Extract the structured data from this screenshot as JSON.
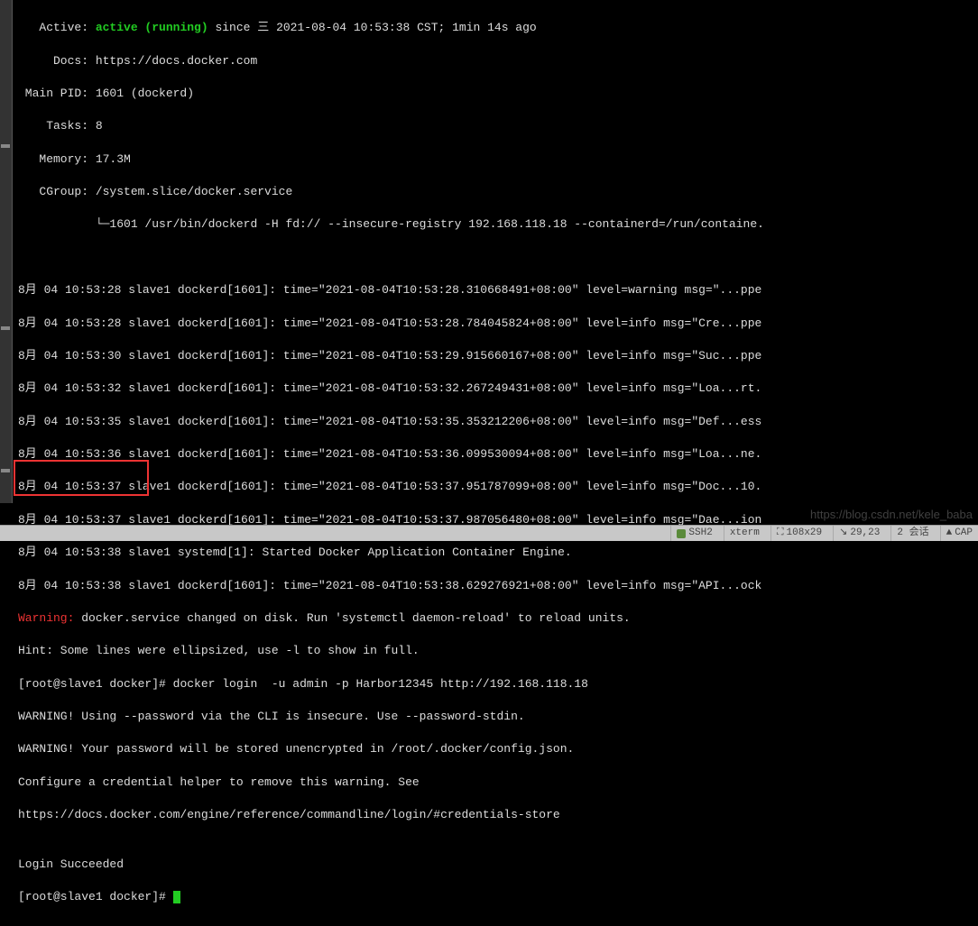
{
  "service_status": {
    "active_label": "   Active: ",
    "active_value": "active (running)",
    "active_suffix": " since 三 2021-08-04 10:53:38 CST; 1min 14s ago",
    "docs_line": "     Docs: https://docs.docker.com",
    "main_pid_line": " Main PID: 1601 (dockerd)",
    "tasks_line": "    Tasks: 8",
    "memory_line": "   Memory: 17.3M",
    "cgroup_line": "   CGroup: /system.slice/docker.service",
    "cgroup_child": "           └─1601 /usr/bin/dockerd -H fd:// --insecure-registry 192.168.118.18 --containerd=/run/containe."
  },
  "log_lines": [
    "8月 04 10:53:28 slave1 dockerd[1601]: time=\"2021-08-04T10:53:28.310668491+08:00\" level=warning msg=\"...ppe",
    "8月 04 10:53:28 slave1 dockerd[1601]: time=\"2021-08-04T10:53:28.784045824+08:00\" level=info msg=\"Cre...ppe",
    "8月 04 10:53:30 slave1 dockerd[1601]: time=\"2021-08-04T10:53:29.915660167+08:00\" level=info msg=\"Suc...ppe",
    "8月 04 10:53:32 slave1 dockerd[1601]: time=\"2021-08-04T10:53:32.267249431+08:00\" level=info msg=\"Loa...rt.",
    "8月 04 10:53:35 slave1 dockerd[1601]: time=\"2021-08-04T10:53:35.353212206+08:00\" level=info msg=\"Def...ess",
    "8月 04 10:53:36 slave1 dockerd[1601]: time=\"2021-08-04T10:53:36.099530094+08:00\" level=info msg=\"Loa...ne.",
    "8月 04 10:53:37 slave1 dockerd[1601]: time=\"2021-08-04T10:53:37.951787099+08:00\" level=info msg=\"Doc...10.",
    "8月 04 10:53:37 slave1 dockerd[1601]: time=\"2021-08-04T10:53:37.987056480+08:00\" level=info msg=\"Dae...ion",
    "8月 04 10:53:38 slave1 systemd[1]: Started Docker Application Container Engine.",
    "8月 04 10:53:38 slave1 dockerd[1601]: time=\"2021-08-04T10:53:38.629276921+08:00\" level=info msg=\"API...ock"
  ],
  "warning_label": "Warning:",
  "warning_text": " docker.service changed on disk. Run 'systemctl daemon-reload' to reload units.",
  "hint_line": "Hint: Some lines were ellipsized, use -l to show in full.",
  "prompt1": "[root@slave1 docker]# ",
  "command1": "docker login  -u admin -p Harbor12345 http://192.168.118.18",
  "output_lines": [
    "WARNING! Using --password via the CLI is insecure. Use --password-stdin.",
    "WARNING! Your password will be stored unencrypted in /root/.docker/config.json.",
    "Configure a credential helper to remove this warning. See",
    "https://docs.docker.com/engine/reference/commandline/login/#credentials-store",
    "",
    "Login Succeeded"
  ],
  "prompt2": "[root@slave1 docker]# ",
  "watermark": "https://blog.csdn.net/kele_baba",
  "statusbar": {
    "ssh": "SSH2",
    "term": "xterm",
    "size": "108x29",
    "pos": "29,23",
    "sess": "2 会话",
    "cap": "CAP"
  }
}
